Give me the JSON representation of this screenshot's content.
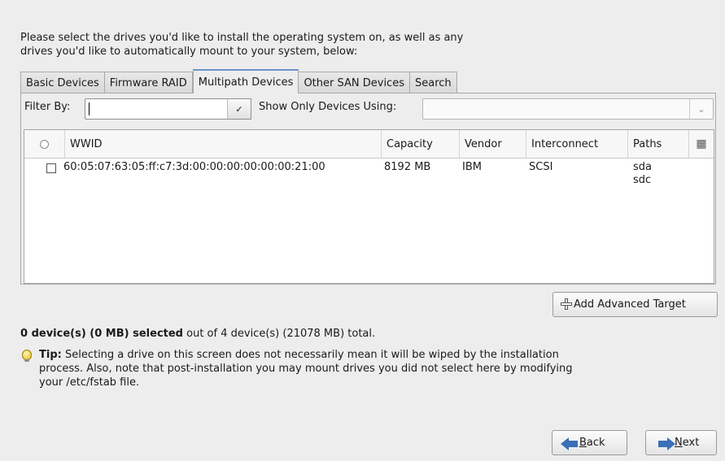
{
  "intro": {
    "line1": "Please select the drives you'd like to install the operating system on, as well as any",
    "line2": "drives you'd like to automatically mount to your system, below:"
  },
  "tabs": [
    {
      "label": "Basic Devices",
      "active": false
    },
    {
      "label": "Firmware RAID",
      "active": false
    },
    {
      "label": "Multipath Devices",
      "active": true
    },
    {
      "label": "Other SAN Devices",
      "active": false
    },
    {
      "label": "Search",
      "active": false
    }
  ],
  "filter": {
    "label": "Filter By:",
    "value": "",
    "dropdown_icon": "chevron-down-icon"
  },
  "show_only": {
    "label": "Show Only Devices Using:",
    "value": ""
  },
  "table": {
    "columns": [
      "WWID",
      "Capacity",
      "Vendor",
      "Interconnect",
      "Paths"
    ],
    "rows": [
      {
        "checked": false,
        "wwid": "60:05:07:63:05:ff:c7:3d:00:00:00:00:00:00:21:00",
        "capacity": "8192 MB",
        "vendor": "IBM",
        "interconnect": "SCSI",
        "paths": [
          "sda",
          "sdc"
        ]
      }
    ]
  },
  "add_target_label": "Add Advanced Target",
  "summary": {
    "bold": "0 device(s) (0 MB) selected",
    "rest": " out of 4 device(s) (21078 MB) total."
  },
  "tip": {
    "bold": "Tip:",
    "text": " Selecting a drive on this screen does not necessarily mean it will be wiped by the installation process.  Also, note that post-installation you may mount drives you did not select here by modifying your /etc/fstab file."
  },
  "buttons": {
    "back_first": "B",
    "back_rest": "ack",
    "next_first": "N",
    "next_rest": "ext"
  }
}
